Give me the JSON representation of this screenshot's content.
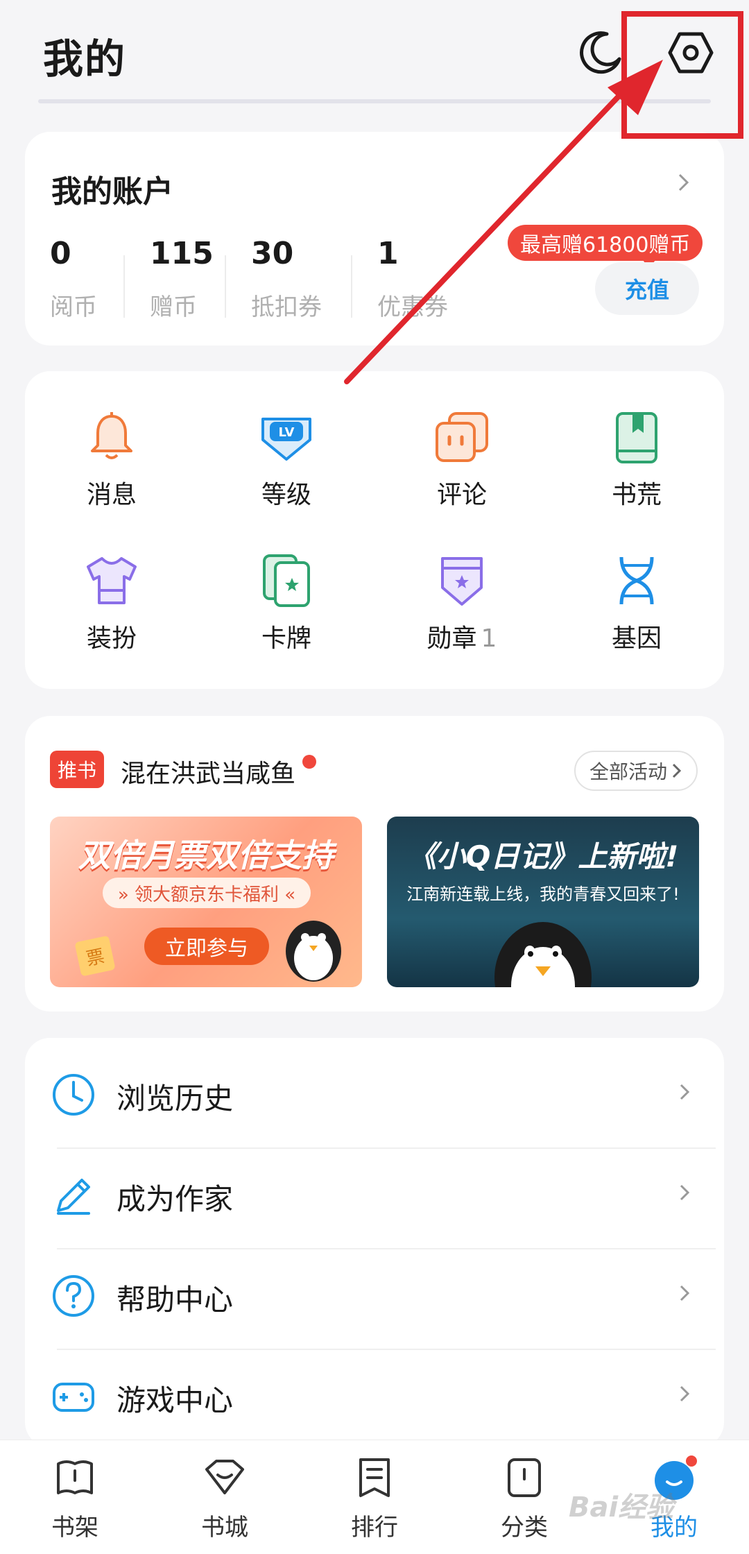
{
  "header": {
    "title": "我的"
  },
  "account": {
    "title": "我的账户",
    "stats": [
      {
        "value": "0",
        "label": "阅币"
      },
      {
        "value": "115",
        "label": "赠币"
      },
      {
        "value": "30",
        "label": "抵扣券"
      },
      {
        "value": "1",
        "label": "优惠券"
      }
    ],
    "promo": "最高赠61800赠币",
    "recharge_label": "充值"
  },
  "features": [
    {
      "label": "消息",
      "icon": "bell-icon",
      "color": "#f07a3a"
    },
    {
      "label": "等级",
      "icon": "level-badge-icon",
      "color": "#1e8fe6"
    },
    {
      "label": "评论",
      "icon": "comment-icon",
      "color": "#f07a3a"
    },
    {
      "label": "书荒",
      "icon": "book-bookmark-icon",
      "color": "#2ea36f"
    },
    {
      "label": "装扮",
      "icon": "tshirt-icon",
      "color": "#8a6ee8"
    },
    {
      "label": "卡牌",
      "icon": "cards-icon",
      "color": "#2ea36f"
    },
    {
      "label": "勋章",
      "count": "1",
      "icon": "medal-icon",
      "color": "#8a6ee8"
    },
    {
      "label": "基因",
      "icon": "dna-icon",
      "color": "#1e8fe6"
    }
  ],
  "activity": {
    "tag": "推书",
    "title": "混在洪武当咸鱼",
    "all_label": "全部活动",
    "banner1": {
      "title": "双倍月票双倍支持",
      "subtitle": "» 领大额京东卡福利 «",
      "button": "立即参与",
      "ticket": "票"
    },
    "banner2": {
      "title": "《小Q日记》上新啦!",
      "subtitle": "江南新连载上线，我的青春又回来了!"
    }
  },
  "menu": [
    {
      "label": "浏览历史",
      "icon": "clock-icon"
    },
    {
      "label": "成为作家",
      "icon": "pencil-icon"
    },
    {
      "label": "帮助中心",
      "icon": "help-icon"
    },
    {
      "label": "游戏中心",
      "icon": "gamepad-icon"
    }
  ],
  "tabs": [
    {
      "label": "书架",
      "icon": "bookshelf-icon"
    },
    {
      "label": "书城",
      "icon": "bookstore-icon"
    },
    {
      "label": "排行",
      "icon": "ranking-icon"
    },
    {
      "label": "分类",
      "icon": "category-icon"
    },
    {
      "label": "我的",
      "icon": "profile-icon",
      "active": true
    }
  ],
  "watermark": "Bai经验"
}
